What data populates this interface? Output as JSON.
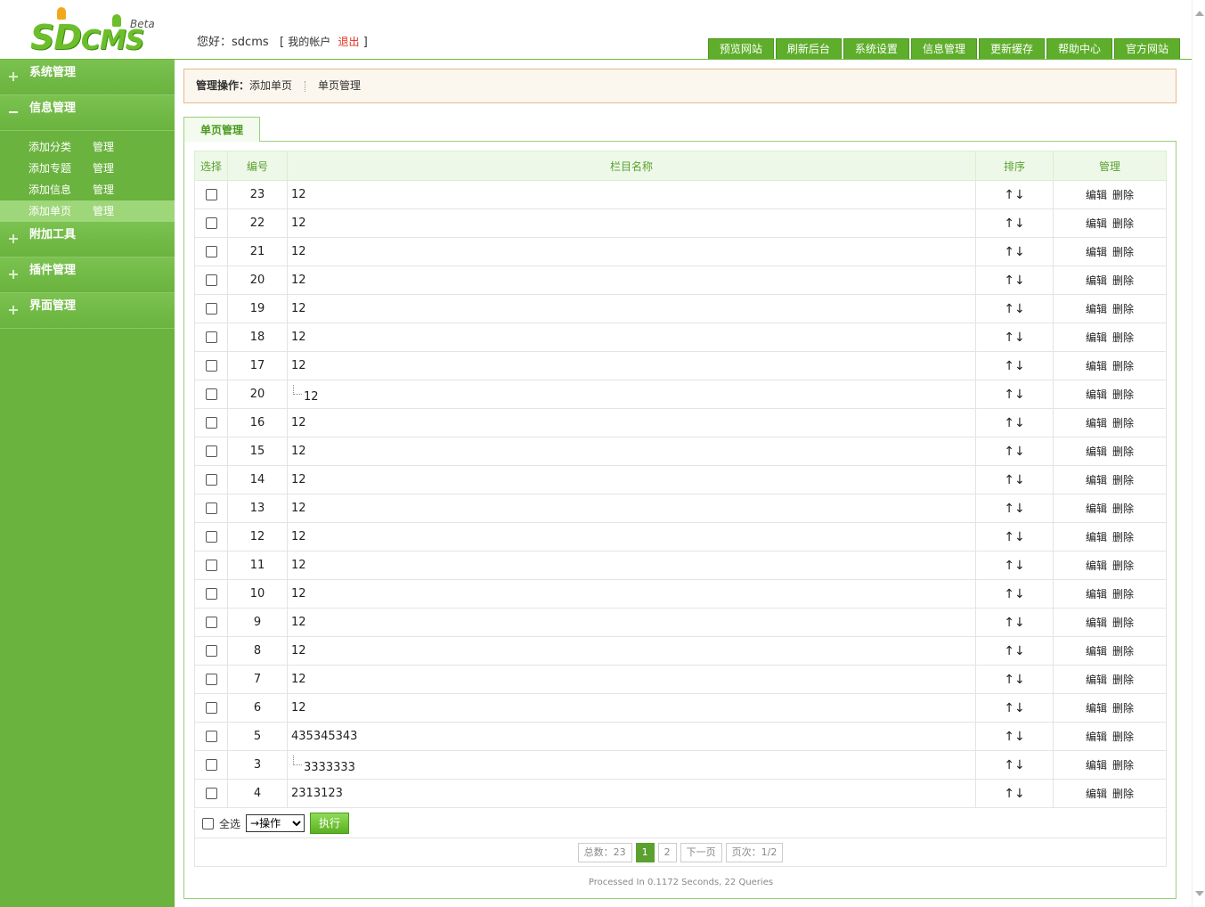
{
  "header": {
    "logo_text_sd": "SD",
    "logo_text_cms": "CMS",
    "logo_beta": "Beta",
    "greeting_prefix": "您好：",
    "username": "sdcms",
    "account_open": "[",
    "account_label": "我的帐户",
    "logout_label": "退出",
    "account_close": "]",
    "nav": [
      "预览网站",
      "刷新后台",
      "系统设置",
      "信息管理",
      "更新缓存",
      "帮助中心",
      "官方网站"
    ]
  },
  "sidebar": {
    "sections": [
      {
        "label": "系统管理",
        "expanded": false
      },
      {
        "label": "信息管理",
        "expanded": true
      },
      {
        "label": "附加工具",
        "expanded": false
      },
      {
        "label": "插件管理",
        "expanded": false
      },
      {
        "label": "界面管理",
        "expanded": false
      }
    ],
    "subitems": [
      {
        "add": "添加分类",
        "manage": "管理"
      },
      {
        "add": "添加专题",
        "manage": "管理"
      },
      {
        "add": "添加信息",
        "manage": "管理"
      },
      {
        "add": "添加单页",
        "manage": "管理",
        "active": true
      }
    ]
  },
  "opbar": {
    "prefix": "管理操作：",
    "link1": "添加单页",
    "link2": "单页管理"
  },
  "tab": {
    "label": "单页管理"
  },
  "table": {
    "headers": [
      "选择",
      "编号",
      "栏目名称",
      "排序",
      "管理"
    ],
    "order_symbol": "↑↓",
    "edit_label": "编辑",
    "delete_label": "删除",
    "rows": [
      {
        "id": "23",
        "name": "12",
        "child": false
      },
      {
        "id": "22",
        "name": "12",
        "child": false
      },
      {
        "id": "21",
        "name": "12",
        "child": false
      },
      {
        "id": "20",
        "name": "12",
        "child": false
      },
      {
        "id": "19",
        "name": "12",
        "child": false
      },
      {
        "id": "18",
        "name": "12",
        "child": false
      },
      {
        "id": "17",
        "name": "12",
        "child": false
      },
      {
        "id": "20",
        "name": "12",
        "child": true
      },
      {
        "id": "16",
        "name": "12",
        "child": false
      },
      {
        "id": "15",
        "name": "12",
        "child": false
      },
      {
        "id": "14",
        "name": "12",
        "child": false
      },
      {
        "id": "13",
        "name": "12",
        "child": false
      },
      {
        "id": "12",
        "name": "12",
        "child": false
      },
      {
        "id": "11",
        "name": "12",
        "child": false
      },
      {
        "id": "10",
        "name": "12",
        "child": false
      },
      {
        "id": "9",
        "name": "12",
        "child": false
      },
      {
        "id": "8",
        "name": "12",
        "child": false
      },
      {
        "id": "7",
        "name": "12",
        "child": false
      },
      {
        "id": "6",
        "name": "12",
        "child": false
      },
      {
        "id": "5",
        "name": "435345343",
        "child": false
      },
      {
        "id": "3",
        "name": "3333333",
        "child": true
      },
      {
        "id": "4",
        "name": "2313123",
        "child": false
      }
    ]
  },
  "actions": {
    "select_all": "全选",
    "operation_selected": "→操作",
    "execute": "执行"
  },
  "pager": {
    "total": "总数：23",
    "pages": [
      "1",
      "2"
    ],
    "current": "1",
    "next": "下一页",
    "page_info": "页次：1/2"
  },
  "footer": {
    "text": "Processed In 0.1172 Seconds, 22 Queries"
  },
  "colors": {
    "brand_green": "#6ab33e",
    "accent_orange": "#e6b98a",
    "logout_red": "#e0301e"
  }
}
